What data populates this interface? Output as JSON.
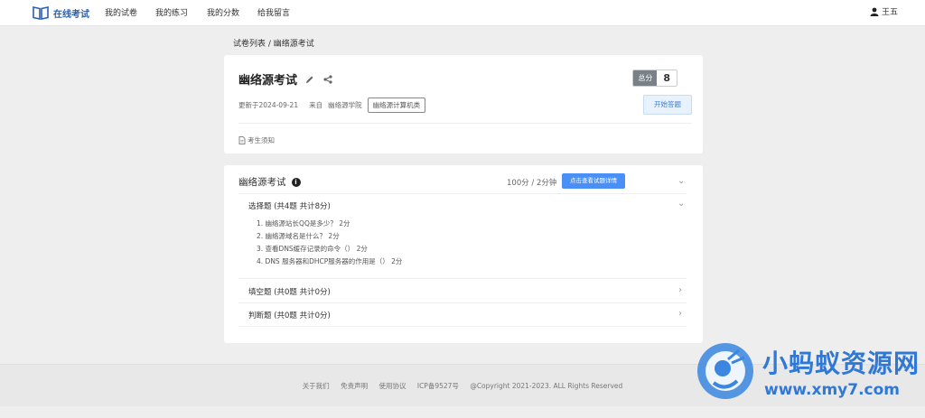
{
  "nav": {
    "brand": "在线考试",
    "items": [
      "我的试卷",
      "我的练习",
      "我的分数",
      "给我留言"
    ],
    "user": "王五"
  },
  "breadcrumb": "试卷列表 / 幽络源考试",
  "exam": {
    "title": "幽络源考试",
    "score_label": "总分",
    "score_value": "8",
    "updated": "更新于2024-09-21",
    "source_prefix": "来自",
    "source": "幽络源学院",
    "tag": "幽络源计算机类",
    "start_label": "开始答题",
    "notice_label": "考生须知"
  },
  "section": {
    "title": "幽络源考试",
    "score_time": "100分 / 2分钟",
    "detail_button": "点击查看试题详情",
    "groups": [
      {
        "title": "选择题 (共4题 共计8分)",
        "questions": [
          "1. 幽络源站长QQ是多少？ 2分",
          "2. 幽络源域名是什么？ 2分",
          "3. 查看DNS缓存记录的命令（） 2分",
          "4. DNS 服务器和DHCP服务器的作用是（） 2分"
        ]
      },
      {
        "title": "填空题 (共0题 共计0分)"
      },
      {
        "title": "判断题 (共0题 共计0分)"
      }
    ]
  },
  "footer": {
    "links": [
      "关于我们",
      "免责声明",
      "使用协议",
      "ICP备9527号"
    ],
    "copyright": "@Copyright 2021-2023. ALL Rights Reserved"
  },
  "watermark": {
    "text": "小蚂蚁资源网",
    "url": "www.xmy7.com"
  },
  "colors": {
    "brand": "#2b5fb0",
    "primary_button": "#4a8ff5",
    "start_button_bg": "#e8f2fd",
    "score_label_bg": "#7a8088",
    "watermark": "#2f78d6"
  }
}
